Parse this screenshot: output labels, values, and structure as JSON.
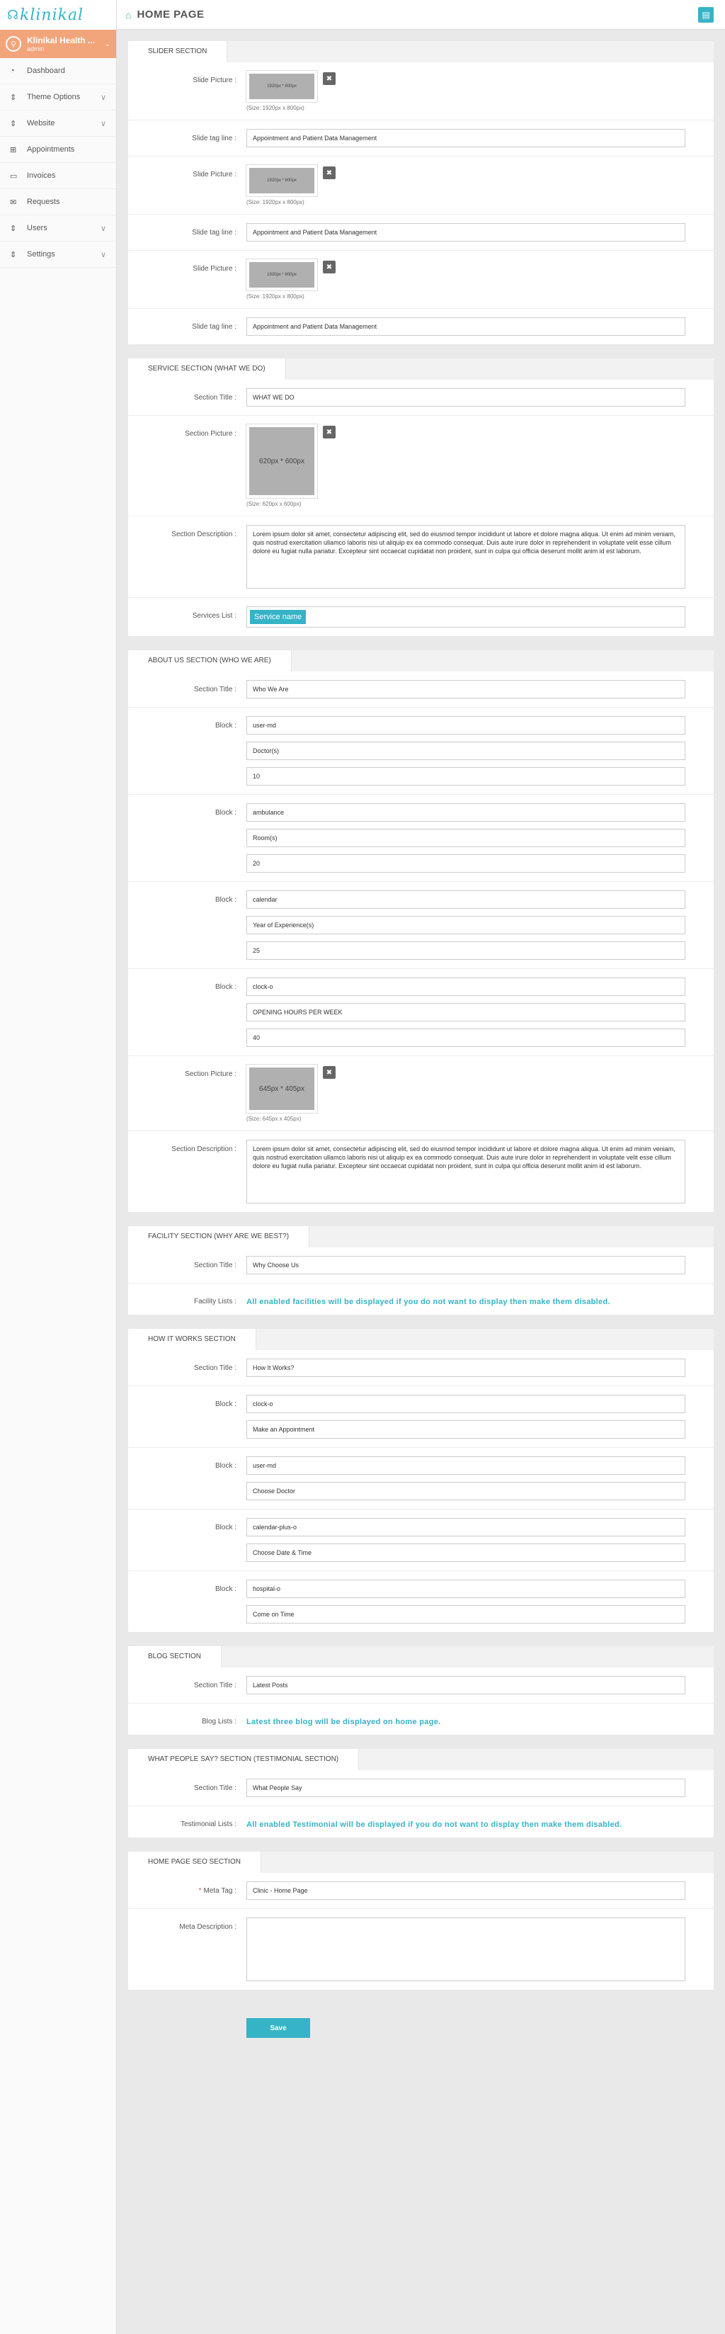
{
  "app": {
    "logo_text": "klinikal",
    "page_title": "HOME PAGE"
  },
  "user": {
    "name": "Klinikal Health ...",
    "role": "admin"
  },
  "sidebar": {
    "items": [
      {
        "label": "Dashboard",
        "icon": "dashboard-icon",
        "glyph": "◔",
        "chevron": ""
      },
      {
        "label": "Theme Options",
        "icon": "sort-icon",
        "glyph": "⇕",
        "chevron": "∨"
      },
      {
        "label": "Website",
        "icon": "sort-icon",
        "glyph": "⇕",
        "chevron": "∨"
      },
      {
        "label": "Appointments",
        "icon": "plus-square-icon",
        "glyph": "⊞",
        "chevron": ""
      },
      {
        "label": "Invoices",
        "icon": "credit-card-icon",
        "glyph": "▭",
        "chevron": ""
      },
      {
        "label": "Requests",
        "icon": "envelope-icon",
        "glyph": "✉",
        "chevron": ""
      },
      {
        "label": "Users",
        "icon": "sort-icon",
        "glyph": "⇕",
        "chevron": "∨"
      },
      {
        "label": "Settings",
        "icon": "sort-icon",
        "glyph": "⇕",
        "chevron": "∨"
      }
    ]
  },
  "slider": {
    "title": "SLIDER SECTION",
    "picture_label": "Slide Picture :",
    "tagline_label": "Slide tag line :",
    "image_text": "1920px * 800px",
    "size_note": "(Size: 1920px x 800px)",
    "tagline": "Appointment and Patient Data Management"
  },
  "service": {
    "title": "SERVICE SECTION (WHAT WE DO)",
    "title_label": "Section Title :",
    "title_value": "WHAT WE DO",
    "picture_label": "Section Picture :",
    "image_text": "620px * 600px",
    "size_note": "(Size: 620px x 600px)",
    "desc_label": "Section Description :",
    "desc": "Lorem ipsum dolor sit amet, consectetur adipiscing elit, sed do eiusmod tempor incididunt ut labore et dolore magna aliqua. Ut enim ad minim veniam, quis nostrud exercitation ullamco laboris nisi ut aliquip ex ea commodo consequat. Duis aute irure dolor in reprehenderit in voluptate velit esse cillum dolore eu fugiat nulla pariatur. Excepteur sint occaecat cupidatat non proident, sunt in culpa qui officia deserunt mollit anim id est laborum.",
    "list_label": "Services List :",
    "tag": "Service name"
  },
  "about": {
    "title": "ABOUT US SECTION (WHO WE ARE)",
    "title_label": "Section Title :",
    "title_value": "Who We Are",
    "block_label": "Block :",
    "blocks": [
      {
        "icon": "user-md",
        "text": "Doctor(s)",
        "num": "10"
      },
      {
        "icon": "ambulance",
        "text": "Room(s)",
        "num": "20"
      },
      {
        "icon": "calendar",
        "text": "Year of Experience(s)",
        "num": "25"
      },
      {
        "icon": "clock-o",
        "text": "OPENING HOURS PER WEEK",
        "num": "40"
      }
    ],
    "picture_label": "Section Picture :",
    "image_text": "645px * 405px",
    "size_note": "(Size: 645px x 405px)",
    "desc_label": "Section Description :",
    "desc": "Lorem ipsum dolor sit amet, consectetur adipiscing elit, sed do eiusmod tempor incididunt ut labore et dolore magna aliqua. Ut enim ad minim veniam, quis nostrud exercitation ullamco laboris nisi ut aliquip ex ea commodo consequat. Duis aute irure dolor in reprehenderit in voluptate velit esse cillum dolore eu fugiat nulla pariatur. Excepteur sint occaecat cupidatat non proident, sunt in culpa qui officia deserunt mollit anim id est laborum."
  },
  "facility": {
    "title": "FACILITY SECTION (WHY ARE WE BEST?)",
    "title_label": "Section Title :",
    "title_value": "Why Choose Us",
    "list_label": "Facility Lists :",
    "info": "All enabled facilities will be displayed if you do not want to display then make them disabled."
  },
  "how": {
    "title": "HOW IT WORKS SECTION",
    "title_label": "Section Title :",
    "title_value": "How It Works?",
    "block_label": "Block :",
    "blocks": [
      {
        "icon": "clock-o",
        "text": "Make an Appointment"
      },
      {
        "icon": "user-md",
        "text": "Choose Doctor"
      },
      {
        "icon": "calendar-plus-o",
        "text": "Choose Date & Time"
      },
      {
        "icon": "hospital-o",
        "text": "Come on Time"
      }
    ]
  },
  "blog": {
    "title": "BLOG SECTION",
    "title_label": "Section Title :",
    "title_value": "Latest Posts",
    "list_label": "Blog Lists :",
    "info": "Latest three blog will be displayed on home page."
  },
  "testimonial": {
    "title": "WHAT PEOPLE SAY? SECTION (TESTIMONIAL SECTION)",
    "title_label": "Section Title :",
    "title_value": "What People Say",
    "list_label": "Testimonial Lists :",
    "info": "All enabled Testimonial will be displayed if you do not want to display then make them disabled."
  },
  "seo": {
    "title": "HOME PAGE SEO SECTION",
    "meta_tag_label": "Meta Tag :",
    "meta_tag_value": "Clinic - Home Page",
    "meta_desc_label": "Meta Description :",
    "meta_desc_value": ""
  },
  "actions": {
    "save_label": "Save"
  },
  "icons": {
    "remove_glyph": "✖",
    "home_glyph": "⌂",
    "top_button_glyph": "▤",
    "user_glyph": "⚲",
    "chevron_glyph": "⌄"
  },
  "colors": {
    "accent": "#36b3c7",
    "user_bg": "#f2a47a",
    "required": "#d9534f"
  }
}
